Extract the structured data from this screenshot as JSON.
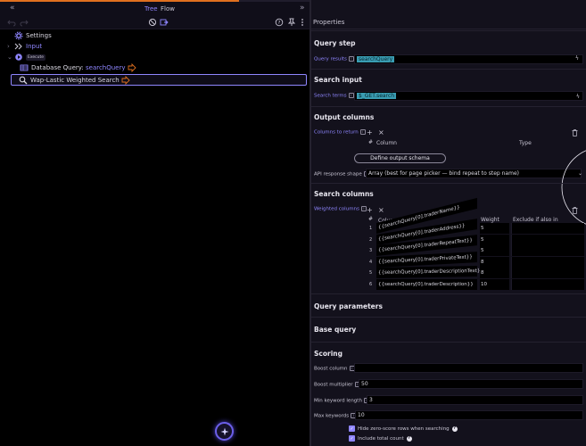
{
  "left_panel": {
    "view_tabs": [
      "Tree",
      "Flow"
    ],
    "tree": {
      "settings": "Settings",
      "input": "Input",
      "execute_badge": "Execute",
      "db_query_prefix": "Database Query: ",
      "db_query_name": "searchQuery",
      "selected_node": "Wap-Lastic Weighted Search"
    }
  },
  "properties": {
    "header": "Properties",
    "query_step": {
      "title": "Query step",
      "label": "Query results",
      "value": "searchQuery"
    },
    "search_input": {
      "title": "Search input",
      "label": "Search terms",
      "value": "$_GET.search"
    },
    "output_columns": {
      "title": "Output columns",
      "label": "Columns to return",
      "grid_index": "#",
      "col_column": "Column",
      "col_type": "Type",
      "define_button": "Define output schema",
      "api_shape_label": "API response shape",
      "api_shape_value": "Array (best for page picker — bind repeat to step name)"
    },
    "search_columns": {
      "title": "Search columns",
      "label": "Weighted columns",
      "grid_index": "#",
      "col_column": "Column",
      "col_weight": "Weight",
      "col_exclude": "Exclude if also in",
      "rows": [
        {
          "n": "1",
          "column": "{{searchQuery[0].traderName}}",
          "weight": "5"
        },
        {
          "n": "2",
          "column": "{{searchQuery[0].traderAddress}}",
          "weight": "5"
        },
        {
          "n": "3",
          "column": "{{searchQuery[0].traderRepeatText}}",
          "weight": "5"
        },
        {
          "n": "4",
          "column": "{{searchQuery[0].traderPrivateText}}",
          "weight": "8"
        },
        {
          "n": "5",
          "column": "{{searchQuery[0].traderDescriptionText}}",
          "weight": "8"
        },
        {
          "n": "6",
          "column": "{{searchQuery[0].traderDescription}}",
          "weight": "10"
        }
      ]
    },
    "query_parameters": {
      "title": "Query parameters"
    },
    "base_query": {
      "title": "Base query"
    },
    "scoring": {
      "title": "Scoring",
      "boost_column_label": "Boost column",
      "boost_column_value": "",
      "boost_multiplier_label": "Boost multiplier",
      "boost_multiplier_value": "50",
      "min_keyword_label": "Min keyword length",
      "min_keyword_value": "3",
      "max_keywords_label": "Max keywords",
      "max_keywords_value": "10",
      "hide_zero_label": "Hide zero-score rows when searching",
      "include_total_label": "Include total count"
    }
  },
  "colors": {
    "accent": "#8f86ff",
    "chip": "#3a9db3",
    "top_accent": "#e0701f"
  }
}
